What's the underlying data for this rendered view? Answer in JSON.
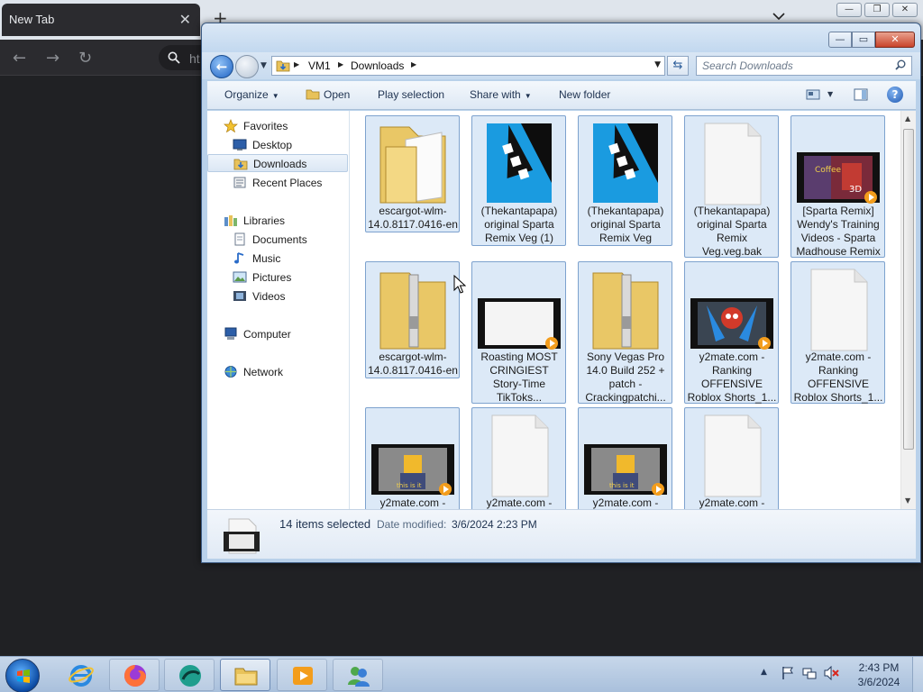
{
  "browser": {
    "tab_title": "New Tab",
    "tab_close": "✕",
    "new_tab": "+",
    "omnibox_partial": "ht",
    "window_buttons": [
      "—",
      "❐",
      "✕"
    ]
  },
  "explorer": {
    "window_buttons": {
      "minimize": "—",
      "maximize": "▭",
      "close": "✕"
    },
    "breadcrumb": [
      "VM1",
      "Downloads"
    ],
    "search_placeholder": "Search Downloads",
    "toolbar": {
      "organize": "Organize",
      "open": "Open",
      "play_selection": "Play selection",
      "share_with": "Share with",
      "new_folder": "New folder",
      "help": "?"
    },
    "nav": {
      "favorites": "Favorites",
      "desktop": "Desktop",
      "downloads": "Downloads",
      "recent_places": "Recent Places",
      "libraries": "Libraries",
      "documents": "Documents",
      "music": "Music",
      "pictures": "Pictures",
      "videos": "Videos",
      "computer": "Computer",
      "network": "Network"
    },
    "files": [
      {
        "name": "escargot-wlm-14.0.8117.0416-en",
        "kind": "folder"
      },
      {
        "name": "(Thekantapapa) original Sparta Remix Veg (1)",
        "kind": "vegas"
      },
      {
        "name": "(Thekantapapa) original Sparta Remix Veg",
        "kind": "vegas"
      },
      {
        "name": "(Thekantapapa) original Sparta Remix Veg.veg.bak",
        "kind": "blank"
      },
      {
        "name": "[Sparta Remix] Wendy's Training Videos - Sparta Madhouse Remix",
        "kind": "video"
      },
      {
        "name": "escargot-wlm-14.0.8117.0416-en",
        "kind": "zip"
      },
      {
        "name": "Roasting MOST CRINGIEST Story-Time TikToks...",
        "kind": "video-white"
      },
      {
        "name": "Sony Vegas Pro 14.0 Build 252 + patch - Crackingpatchi...",
        "kind": "zip"
      },
      {
        "name": "y2mate.com - Ranking OFFENSIVE Roblox Shorts_1...",
        "kind": "video-robot"
      },
      {
        "name": "y2mate.com - Ranking OFFENSIVE Roblox Shorts_1...",
        "kind": "blank"
      },
      {
        "name": "y2mate.com -",
        "kind": "video-roblox"
      },
      {
        "name": "y2mate.com -",
        "kind": "blank"
      },
      {
        "name": "y2mate.com -",
        "kind": "video-roblox"
      },
      {
        "name": "y2mate.com -",
        "kind": "blank"
      }
    ],
    "details": {
      "selected_count": "14 items selected",
      "date_modified_label": "Date modified:",
      "date_modified_value": "3/6/2024 2:23 PM"
    }
  },
  "taskbar": {
    "clock_time": "2:43 PM",
    "clock_date": "3/6/2024",
    "tray_show_hidden": "▲"
  },
  "colors": {
    "explorer_frame": "#b9d1ea",
    "selection_fill": "#dce9f7",
    "selection_border": "#7da2ce",
    "taskbar": "#a9c0dc"
  }
}
